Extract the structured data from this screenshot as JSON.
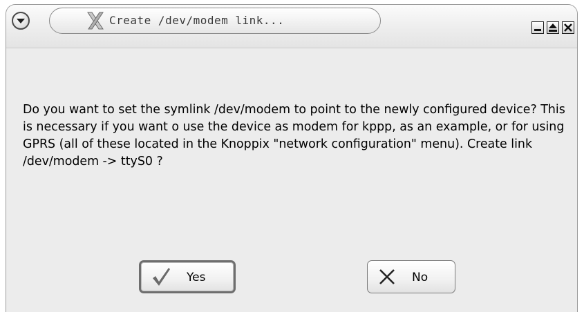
{
  "window": {
    "title": "Create /dev/modem link...",
    "controls": {
      "menu_icon": "window-menu-icon",
      "minimize_icon": "minimize-icon",
      "maximize_icon": "maximize-icon",
      "close_icon": "close-icon"
    }
  },
  "dialog": {
    "message": "Do you want to set the symlink /dev/modem to point to the newly configured device? This is necessary if you want o use the device as modem for kppp, as an example, or for using GPRS (all of these located in the Knoppix \"network configuration\" menu). Create link /dev/modem -> ttyS0 ?",
    "buttons": {
      "yes_label": "Yes",
      "yes_icon": "checkmark-icon",
      "no_label": "No",
      "no_icon": "x-icon"
    }
  },
  "colors": {
    "dialog_background": "#ececec",
    "text": "#000000"
  }
}
